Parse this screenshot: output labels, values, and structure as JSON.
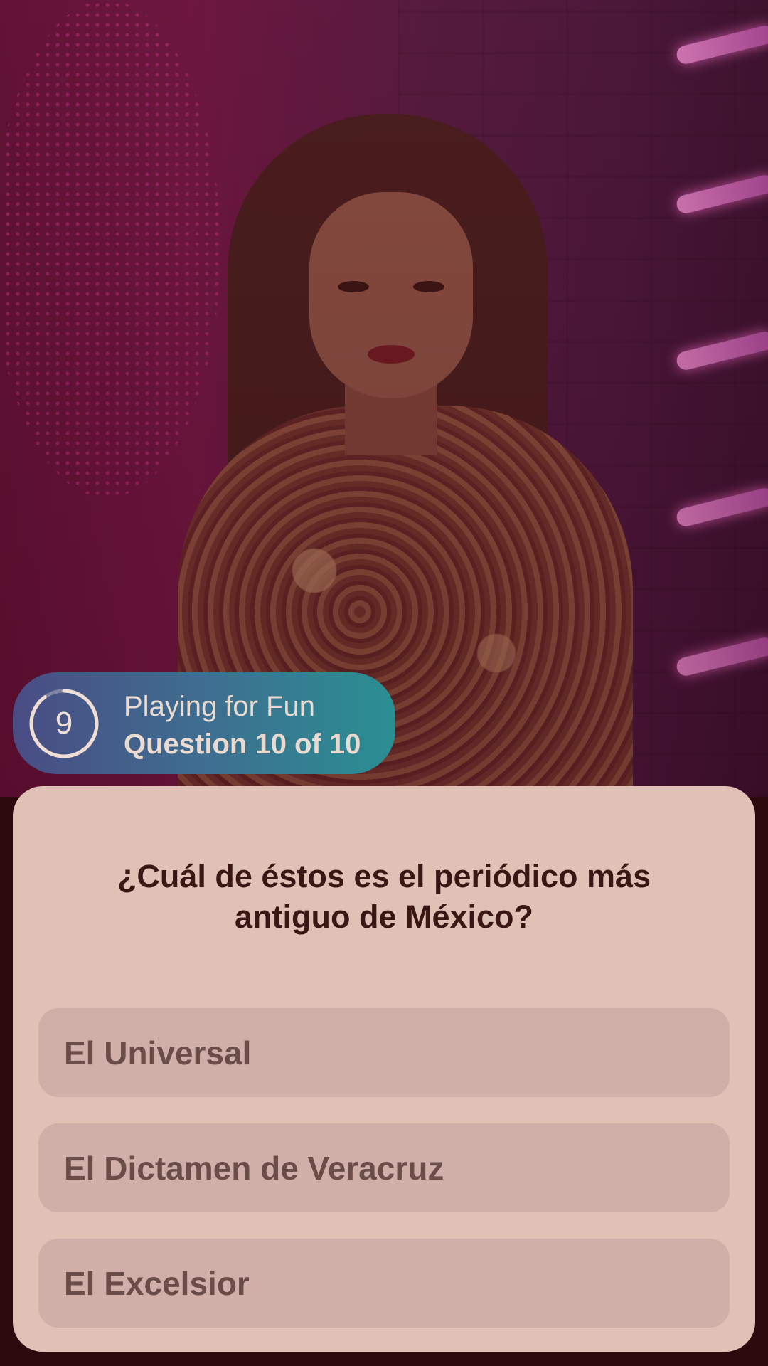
{
  "status": {
    "timer_value": "9",
    "timer_progress": 0.9,
    "mode": "Playing for Fun",
    "progress": "Question 10 of 10"
  },
  "question": {
    "text": "¿Cuál de éstos es el periódico más antiguo de México?"
  },
  "answers": [
    {
      "label": "El Universal"
    },
    {
      "label": "El Dictamen de Veracruz"
    },
    {
      "label": "El Excelsior"
    }
  ],
  "colors": {
    "card_background": "#dfc1b5",
    "answer_background": "#cfafa7",
    "question_text": "#3a1614",
    "answer_text": "#6a4c48",
    "pill_gradient_start": "#4a4c84",
    "pill_gradient_end": "#2a8f92"
  }
}
